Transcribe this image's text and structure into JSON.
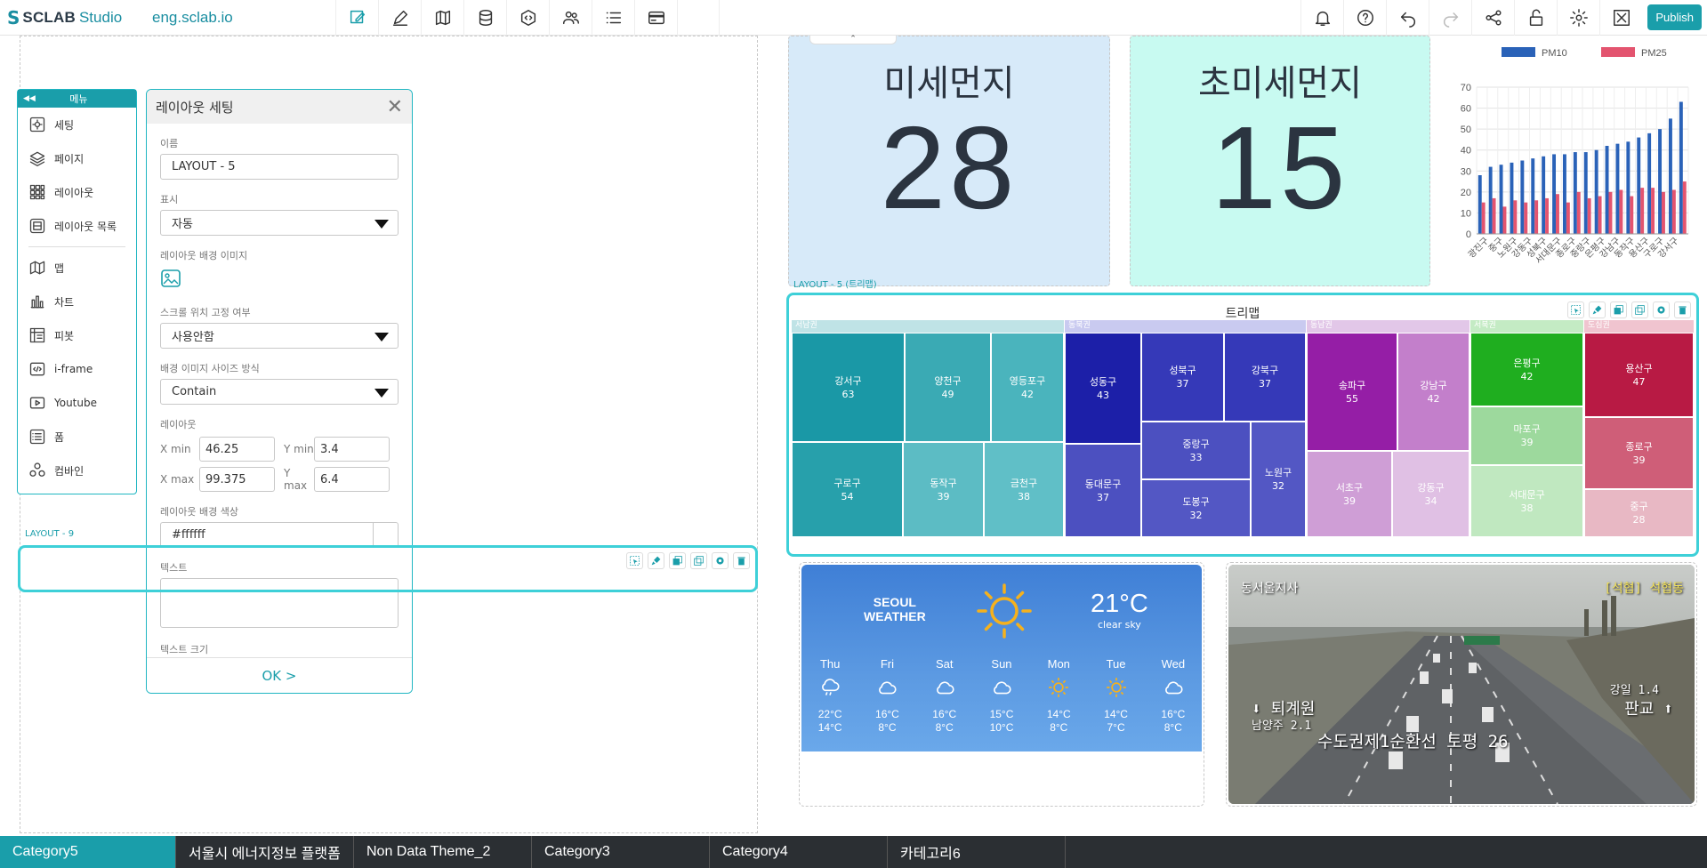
{
  "app": {
    "brand": "SCLAB",
    "product": "Studio",
    "site": "eng.sclab.io",
    "publish_label": "Publish"
  },
  "toolbar_left_icons": [
    "edit-mode-icon",
    "pencil-icon",
    "map-book-icon",
    "database-icon",
    "code-icon",
    "users-icon",
    "list-icon",
    "card-icon"
  ],
  "toolbar_right_icons": [
    "bell-icon",
    "help-icon",
    "undo-icon",
    "redo-icon",
    "share-icon",
    "unlock-icon",
    "gear-icon",
    "fullscreen-icon"
  ],
  "side_menu": {
    "title": "메뉴",
    "items": [
      {
        "label": "세팅",
        "icon": "settings-icon"
      },
      {
        "label": "페이지",
        "icon": "layers-icon"
      },
      {
        "label": "레이아웃",
        "icon": "grid-icon"
      },
      {
        "label": "레이아웃 목록",
        "icon": "layout-list-icon"
      },
      {
        "label": "맵",
        "icon": "map-icon"
      },
      {
        "label": "차트",
        "icon": "chart-icon"
      },
      {
        "label": "피봇",
        "icon": "pivot-icon"
      },
      {
        "label": "i-frame",
        "icon": "iframe-icon"
      },
      {
        "label": "Youtube",
        "icon": "youtube-icon"
      },
      {
        "label": "폼",
        "icon": "form-icon"
      },
      {
        "label": "컴바인",
        "icon": "combine-icon"
      }
    ]
  },
  "layout_panel": {
    "title": "레이아웃 세팅",
    "name_label": "이름",
    "name_value": "LAYOUT - 5",
    "display_label": "표시",
    "display_value": "자동",
    "bg_image_label": "레이아웃 배경 이미지",
    "scroll_label": "스크롤 위치 고정 여부",
    "scroll_value": "사용안함",
    "bg_size_label": "배경 이미지 사이즈 방식",
    "bg_size_value": "Contain",
    "layout_label": "레이아웃",
    "xmin_label": "X min",
    "xmin_value": "46.25",
    "ymin_label": "Y min",
    "ymin_value": "3.4",
    "xmax_label": "X max",
    "xmax_value": "99.375",
    "ymax_label": "Y max",
    "ymax_value": "6.4",
    "bg_color_label": "레이아웃 배경 색상",
    "bg_color_value": "#ffffff",
    "text_label": "텍스트",
    "text_size_label": "텍스트 크기",
    "ok_label": "OK >"
  },
  "layout9_label": "LAYOUT - 9",
  "treemap_layout_label": "LAYOUT - 5 (트리맵)",
  "kpis": [
    {
      "title": "미세먼지",
      "value": "28"
    },
    {
      "title": "초미세먼지",
      "value": "15"
    }
  ],
  "chart_data": {
    "type": "bar",
    "categories": [
      "광진구",
      "중구",
      "노원구",
      "강동구",
      "성북구",
      "서대문구",
      "종로구",
      "중랑구",
      "은평구",
      "강남구",
      "동작구",
      "용산구",
      "구로구",
      "강서구"
    ],
    "series": [
      {
        "name": "PM10",
        "color": "#2a62b8",
        "values": [
          28,
          32,
          33,
          34,
          35,
          36,
          37,
          38,
          38,
          39,
          39,
          40,
          42,
          43,
          44,
          46,
          48,
          50,
          55,
          63
        ]
      },
      {
        "name": "PM25",
        "color": "#e3546f",
        "values": [
          15,
          17,
          13,
          16,
          15,
          16,
          17,
          19,
          15,
          20,
          17,
          18,
          20,
          21,
          18,
          22,
          22,
          20,
          21,
          25
        ]
      }
    ],
    "ylim": [
      0,
      70
    ],
    "yticks": [
      "0",
      "10",
      "20",
      "30",
      "40",
      "50",
      "60",
      "70"
    ],
    "legend": "top",
    "grid": true
  },
  "treemap": {
    "title": "트리맵",
    "groups": [
      {
        "name": "서남권",
        "color": "#1aa2a8",
        "cells": [
          {
            "name": "강서구",
            "value": "63"
          },
          {
            "name": "양천구",
            "value": "49"
          },
          {
            "name": "영등포구",
            "value": "42"
          },
          {
            "name": "구로구",
            "value": "54"
          },
          {
            "name": "동작구",
            "value": "39"
          },
          {
            "name": "금천구",
            "value": "38"
          }
        ]
      },
      {
        "name": "동북권",
        "color": "#2a2fb8",
        "cells": [
          {
            "name": "성동구",
            "value": "43"
          },
          {
            "name": "성북구",
            "value": "37"
          },
          {
            "name": "강북구",
            "value": "37"
          },
          {
            "name": "중랑구",
            "value": "33"
          },
          {
            "name": "동대문구",
            "value": "37"
          },
          {
            "name": "노원구",
            "value": "32"
          },
          {
            "name": "도봉구",
            "value": "32"
          }
        ]
      },
      {
        "name": "동남권",
        "color": "#9a1aa8",
        "cells": [
          {
            "name": "송파구",
            "value": "55"
          },
          {
            "name": "강남구",
            "value": "42"
          },
          {
            "name": "서초구",
            "value": "39"
          },
          {
            "name": "강동구",
            "value": "34"
          }
        ]
      },
      {
        "name": "서북권",
        "color": "#1fae1f",
        "cells": [
          {
            "name": "은평구",
            "value": "42"
          },
          {
            "name": "마포구",
            "value": "39"
          },
          {
            "name": "서대문구",
            "value": "38"
          }
        ]
      },
      {
        "name": "도심권",
        "color": "#b81a44",
        "cells": [
          {
            "name": "용산구",
            "value": "47"
          },
          {
            "name": "종로구",
            "value": "39"
          },
          {
            "name": "중구",
            "value": "28"
          }
        ]
      }
    ]
  },
  "weather": {
    "city": "SEOUL",
    "subtitle": "WEATHER",
    "temp": "21°C",
    "desc": "clear sky",
    "days": [
      {
        "day": "Thu",
        "icon": "rain-cloud-icon",
        "high": "22°C",
        "low": "14°C"
      },
      {
        "day": "Fri",
        "icon": "cloud-icon",
        "high": "16°C",
        "low": "8°C"
      },
      {
        "day": "Sat",
        "icon": "cloud-icon",
        "high": "16°C",
        "low": "8°C"
      },
      {
        "day": "Sun",
        "icon": "cloud-icon",
        "high": "15°C",
        "low": "10°C"
      },
      {
        "day": "Mon",
        "icon": "sun-icon",
        "high": "14°C",
        "low": "8°C"
      },
      {
        "day": "Tue",
        "icon": "sun-icon",
        "high": "14°C",
        "low": "7°C"
      },
      {
        "day": "Wed",
        "icon": "cloud-icon",
        "high": "16°C",
        "low": "8°C"
      }
    ]
  },
  "cctv": {
    "station": "동서울지사",
    "tag": "[석협] 석협동",
    "left_sign": "⬇ 퇴계원",
    "left_sub": "남양주 2.1",
    "right_sign": "판교 ⬆",
    "right_sub": "강일 1.4",
    "caption": "수도권제1순환선 토평 26"
  },
  "tabs": [
    {
      "label": "Category5",
      "active": true
    },
    {
      "label": "서울시 에너지정보 플랫폼",
      "active": false
    },
    {
      "label": "Non Data Theme_2",
      "active": false
    },
    {
      "label": "Category3",
      "active": false
    },
    {
      "label": "Category4",
      "active": false
    },
    {
      "label": "카테고리6",
      "active": false
    }
  ]
}
